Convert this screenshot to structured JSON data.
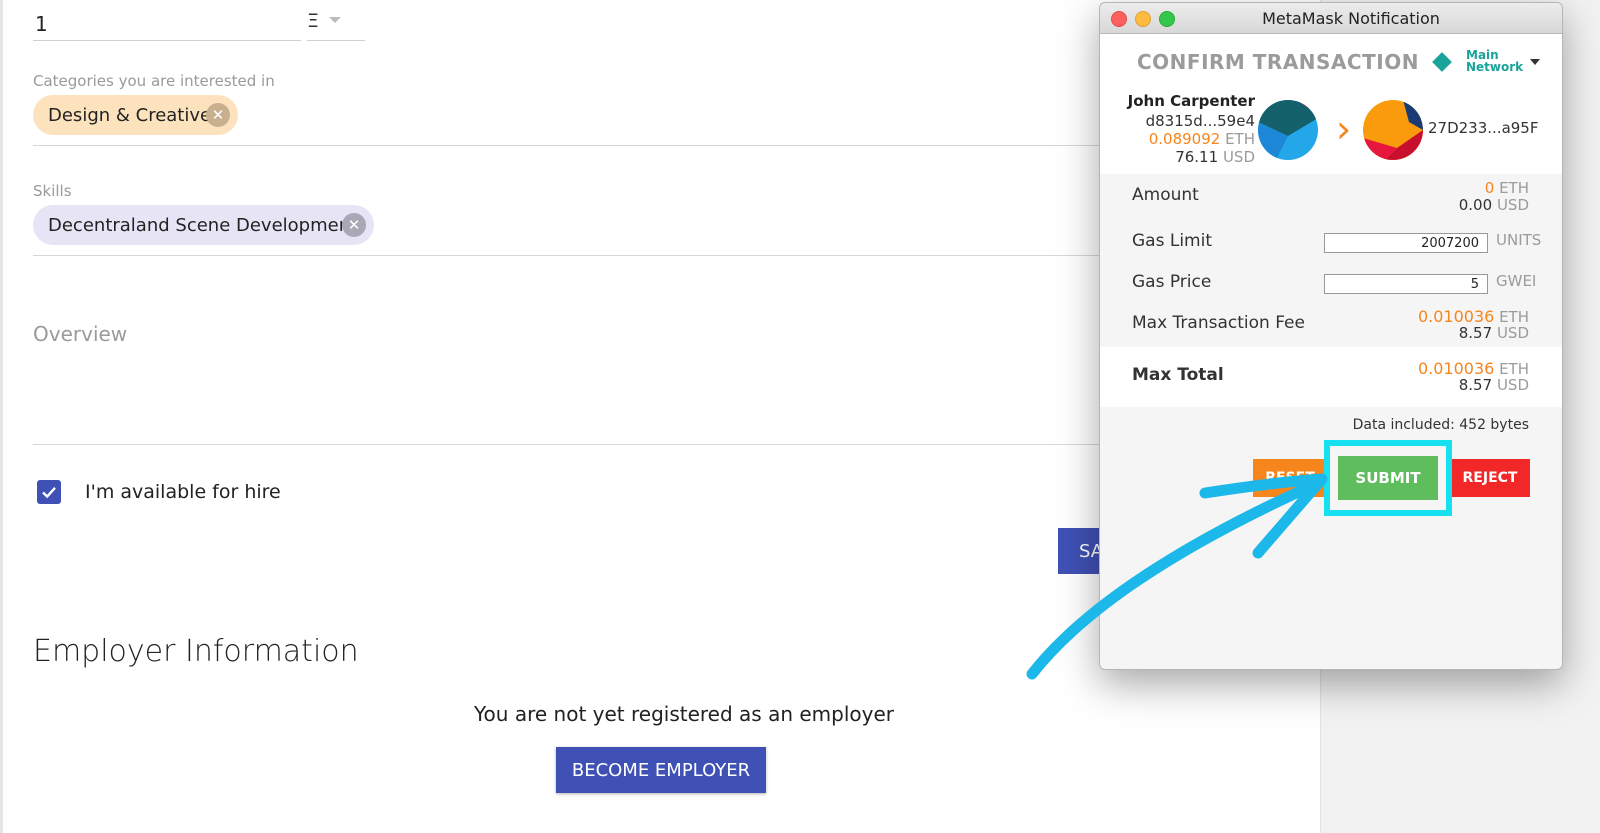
{
  "form": {
    "rate_value": "1",
    "currency_symbol": "Ξ",
    "categories_label": "Categories you are interested in",
    "categories_chip": "Design & Creative",
    "skills_label": "Skills",
    "skills_chip": "Decentraland Scene Development",
    "overview_label": "Overview",
    "available_label": "I'm available for hire",
    "available_checked": true,
    "save_label": "SAVE"
  },
  "employer": {
    "title": "Employer Information",
    "message": "You are not yet registered as an employer",
    "button_label": "BECOME EMPLOYER"
  },
  "metamask": {
    "window_title": "MetaMask Notification",
    "heading": "CONFIRM TRANSACTION",
    "network_label": "Main Network",
    "network_color": "#1aa39a",
    "from": {
      "name": "John Carpenter",
      "address": "d8315d...59e4",
      "balance_eth": "0.089092",
      "eth_unit": "ETH",
      "balance_usd": "76.11",
      "usd_unit": "USD"
    },
    "to_address": "27D233...a95F",
    "amount": {
      "label": "Amount",
      "eth": "0",
      "eth_unit": "ETH",
      "usd": "0.00",
      "usd_unit": "USD"
    },
    "gas_limit": {
      "label": "Gas Limit",
      "value": "2007200",
      "unit": "UNITS"
    },
    "gas_price": {
      "label": "Gas Price",
      "value": "5",
      "unit": "GWEI"
    },
    "max_fee": {
      "label": "Max Transaction Fee",
      "eth": "0.010036",
      "eth_unit": "ETH",
      "usd": "8.57",
      "usd_unit": "USD"
    },
    "max_total": {
      "label": "Max Total",
      "eth": "0.010036",
      "eth_unit": "ETH",
      "usd": "8.57",
      "usd_unit": "USD"
    },
    "data_included": "Data included: 452 bytes",
    "buttons": {
      "reset": "RESET",
      "submit": "SUBMIT",
      "reject": "REJECT"
    },
    "colors": {
      "accent_orange": "#f6851b",
      "submit_green": "#5fbd5e",
      "reject_red": "#f22727",
      "highlight_cyan": "#17e0f0"
    }
  },
  "accent": "#3f51b5"
}
